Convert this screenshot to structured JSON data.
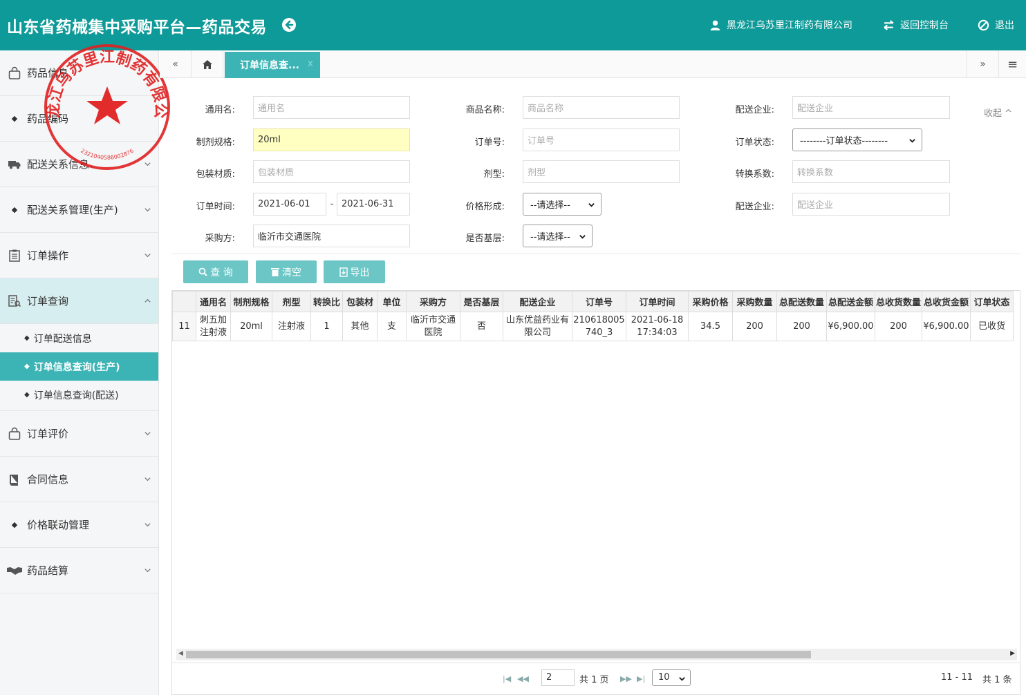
{
  "header": {
    "title": "山东省药械集中采购平台—药品交易",
    "company": "黑龙江乌苏里江制药有限公司",
    "console": "返回控制台",
    "logout": "退出"
  },
  "stamp": {
    "text": "黑龙江乌苏里江制药有限公司",
    "number": "2321040586002876"
  },
  "sidebar": {
    "items": [
      {
        "label": "药品信息"
      },
      {
        "label": "药品编码"
      },
      {
        "label": "配送关系信息"
      },
      {
        "label": "配送关系管理(生产)"
      },
      {
        "label": "订单操作"
      },
      {
        "label": "订单查询"
      },
      {
        "label": "订单评价"
      },
      {
        "label": "合同信息"
      },
      {
        "label": "价格联动管理"
      },
      {
        "label": "药品结算"
      }
    ],
    "sub": [
      {
        "label": "订单配送信息"
      },
      {
        "label": "订单信息查询(生产)"
      },
      {
        "label": "订单信息查询(配送)"
      }
    ]
  },
  "tabs": {
    "active": "订单信息查...",
    "close": "x",
    "left_nav": "«",
    "right_nav": "»",
    "menu": "≡"
  },
  "form": {
    "generic_name": {
      "label": "通用名:",
      "placeholder": "通用名"
    },
    "product_name": {
      "label": "商品名称:",
      "placeholder": "商品名称"
    },
    "dist_company": {
      "label": "配送企业:",
      "placeholder": "配送企业"
    },
    "spec": {
      "label": "制剂规格:",
      "value": "20ml"
    },
    "order_no": {
      "label": "订单号:",
      "placeholder": "订单号"
    },
    "order_status": {
      "label": "订单状态:",
      "value": "--------订单状态--------"
    },
    "packaging": {
      "label": "包装材质:",
      "placeholder": "包装材质"
    },
    "dosage": {
      "label": "剂型:",
      "placeholder": "剂型"
    },
    "conversion": {
      "label": "转换系数:",
      "placeholder": "转换系数"
    },
    "order_time": {
      "label": "订单时间:",
      "from": "2021-06-01",
      "dash": "-",
      "to": "2021-06-31"
    },
    "price_form": {
      "label": "价格形成:",
      "value": "--请选择--"
    },
    "dist_company2": {
      "label": "配送企业:",
      "placeholder": "配送企业"
    },
    "buyer": {
      "label": "采购方:",
      "value": "临沂市交通医院"
    },
    "is_basic": {
      "label": "是否基层:",
      "value": "--请选择--"
    },
    "collapse": "收起 ^"
  },
  "buttons": {
    "query": "查 询",
    "clear": "清空",
    "export": "导出"
  },
  "table": {
    "headers": [
      "",
      "通用名",
      "制剂规格",
      "剂型",
      "转换比",
      "包装材",
      "单位",
      "采购方",
      "是否基层",
      "配送企业",
      "订单号",
      "订单时间",
      "采购价格",
      "采购数量",
      "总配送数量",
      "总配送金额",
      "总收货数量",
      "总收货金额",
      "订单状态"
    ],
    "rows": [
      [
        "11",
        "刺五加注射液",
        "20ml",
        "注射液",
        "1",
        "其他",
        "支",
        "临沂市交通医院",
        "否",
        "山东优益药业有限公司",
        "210618005740_3",
        "2021-06-18 17:34:03",
        "34.5",
        "200",
        "200",
        "¥6,900.00",
        "200",
        "¥6,900.00",
        "已收货"
      ]
    ]
  },
  "pager": {
    "page": "2",
    "total_pages": "共 1 页",
    "page_size": "10",
    "range": "11 - 11",
    "total": "共 1 条"
  }
}
